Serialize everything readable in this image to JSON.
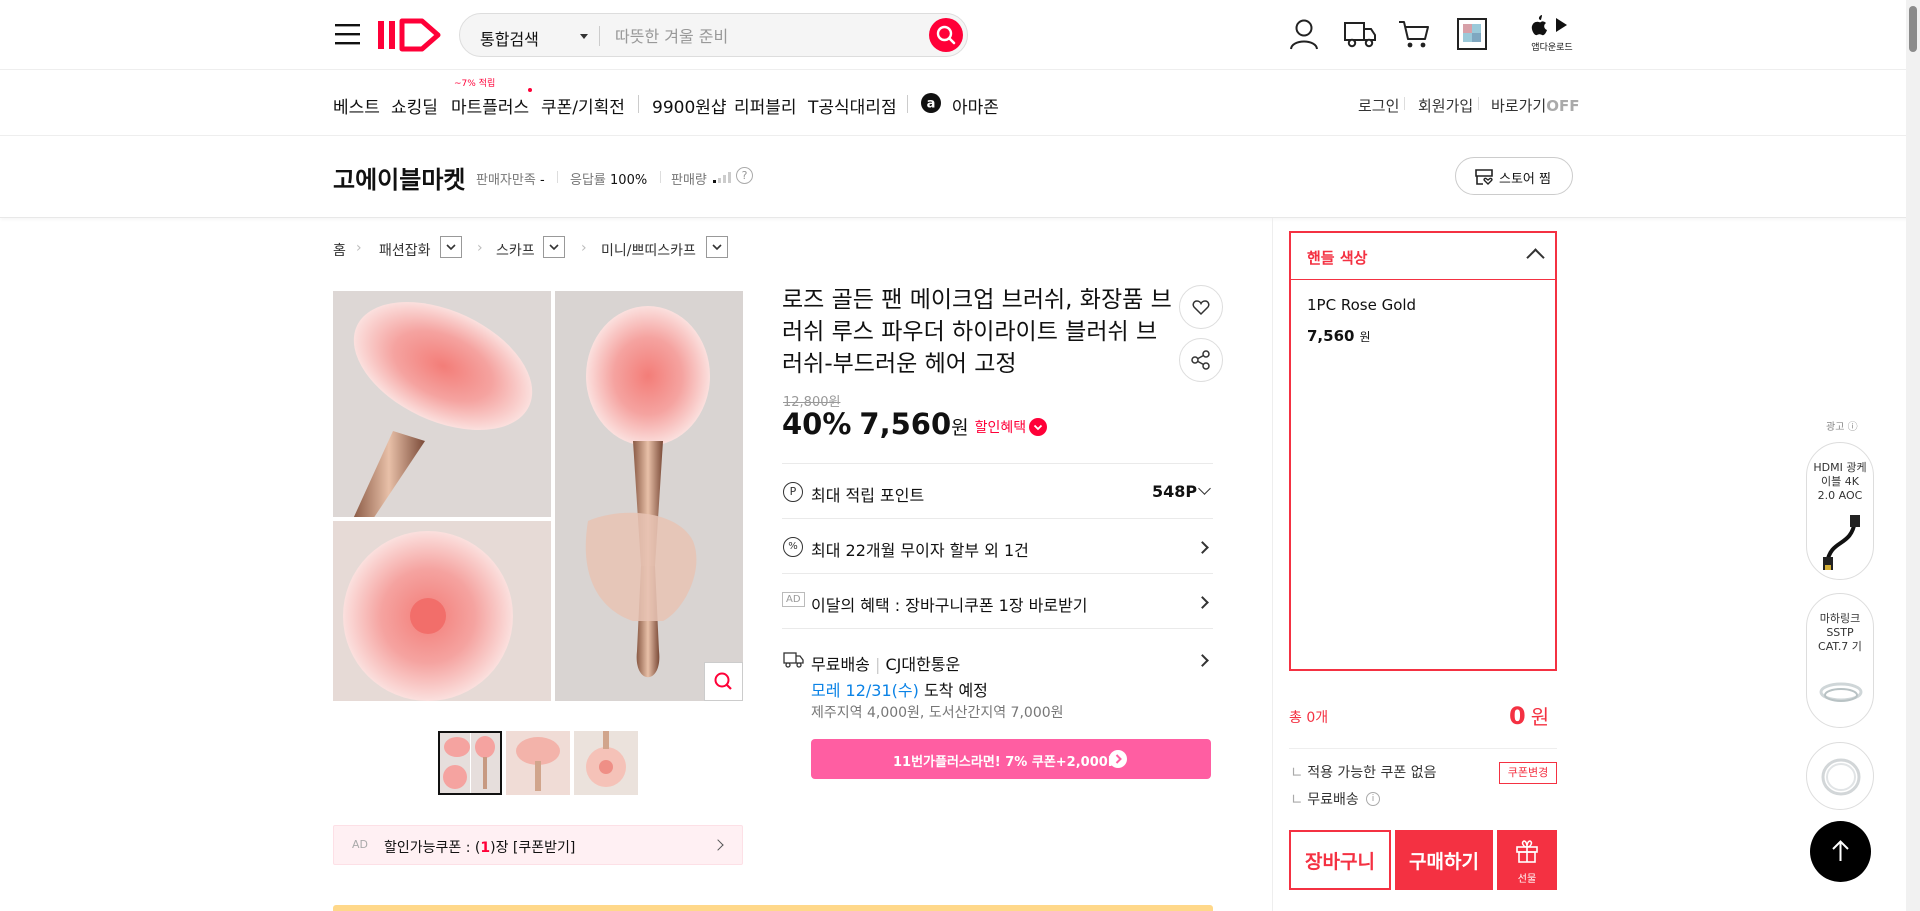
{
  "header": {
    "search_scope": "통합검색",
    "search_placeholder": "따뜻한 겨울 준비",
    "app_download": "앱다운로드"
  },
  "nav": {
    "items": [
      "베스트",
      "쇼킹딜",
      "마트플러스",
      "쿠폰/기획전",
      "9900원샵",
      "리퍼블리",
      "T공식대리점",
      "아마존"
    ],
    "mart_badge": "~7% 적립",
    "links": [
      "로그인",
      "회원가입",
      "바로가기"
    ],
    "shortcut_state": "OFF"
  },
  "seller": {
    "name": "고에이블마켓",
    "satisfaction_label": "판매자만족",
    "satisfaction_value": "-",
    "response_label": "응답률",
    "response_value": "100%",
    "sales_label": "판매량",
    "store_btn": "스토어 찜"
  },
  "breadcrumb": [
    "홈",
    "패션잡화",
    "스카프",
    "미니/쁘띠스카프"
  ],
  "product": {
    "title": "로즈 골든 팬 메이크업 브러쉬, 화장품 브러쉬 루스 파우더 하이라이트 블러쉬 브러쉬-부드러운 헤어 고정",
    "original_price": "12,800원",
    "discount": "40%",
    "price": "7,560",
    "price_unit": "원",
    "discount_benefit": "할인혜택",
    "point_label": "최대 적립 포인트",
    "point_value": "548P",
    "installment": "최대 22개월 무이자 할부 외 1건",
    "ad_badge": "AD",
    "monthly_benefit": "이달의 혜택 : 장바구니쿠폰 1장 바로받기",
    "shipping_free": "무료배송",
    "courier": "CJ대한통운",
    "arrival_date": "모레 12/31(수)",
    "arrival_suffix": "도착 예정",
    "extra_shipping": "제주지역 4,000원, 도서산간지역 7,000원",
    "promo": "11번가플러스라면! 7% 쿠폰+2,000P",
    "coupon_ad": "AD",
    "coupon_prefix": "할인가능쿠폰 : (",
    "coupon_count": "1",
    "coupon_suffix": ")장 [쿠폰받기]"
  },
  "order_panel": {
    "option_title": "핸들 색상",
    "option_name": "1PC Rose Gold",
    "option_price": "7,560",
    "option_unit": "원",
    "total_label": "총 0개",
    "total_value": "0",
    "total_unit": "원",
    "coupon_none": "적용 가능한 쿠폰 없음",
    "coupon_change": "쿠폰변경",
    "free_shipping": "무료배송",
    "cart_btn": "장바구니",
    "buy_btn": "구매하기",
    "gift_btn": "선물"
  },
  "side_ads": {
    "label": "광고",
    "ad1": "HDMI 광케이블 4K 2.0 AOC",
    "ad2": "마하링크 SSTP CAT.7 기"
  },
  "colors": {
    "brand_red": "#ff0038",
    "accent_red": "#f43142",
    "promo_pink": "#ff5ea2",
    "link_blue": "#0b83e6"
  }
}
